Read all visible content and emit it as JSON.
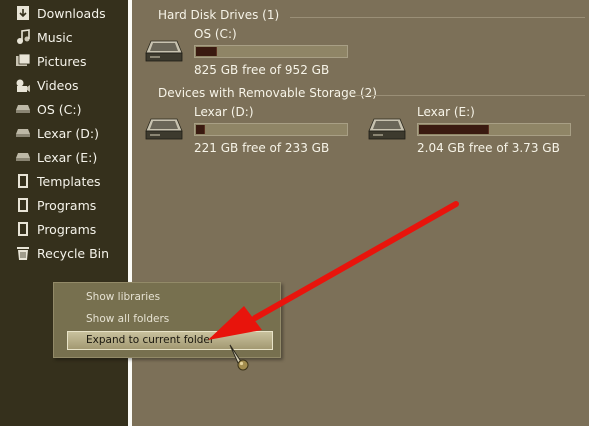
{
  "sidebar": {
    "items": [
      {
        "label": "Downloads",
        "icon": "downloads-icon"
      },
      {
        "label": "Music",
        "icon": "music-icon"
      },
      {
        "label": "Pictures",
        "icon": "pictures-icon"
      },
      {
        "label": "Videos",
        "icon": "videos-icon"
      },
      {
        "label": "OS (C:)",
        "icon": "drive-icon"
      },
      {
        "label": "Lexar (D:)",
        "icon": "drive-icon"
      },
      {
        "label": "Lexar (E:)",
        "icon": "drive-icon"
      },
      {
        "label": "Templates",
        "icon": "folder-icon"
      },
      {
        "label": "Programs",
        "icon": "folder-icon"
      },
      {
        "label": "Programs",
        "icon": "folder-icon"
      },
      {
        "label": "Recycle Bin",
        "icon": "recycle-bin-icon"
      }
    ]
  },
  "main": {
    "hard_disk_header": "Hard Disk Drives (1)",
    "removable_header": "Devices with Removable Storage (2)",
    "drives": [
      {
        "name": "OS (C:)",
        "free_text": "825 GB free of 952 GB",
        "used_fraction": 0.133
      },
      {
        "name": "Lexar (D:)",
        "free_text": "221 GB free of 233 GB",
        "used_fraction": 0.052
      },
      {
        "name": "Lexar (E:)",
        "free_text": "2.04 GB free of 3.73 GB",
        "used_fraction": 0.453
      }
    ]
  },
  "context_menu": {
    "items": [
      {
        "label": "Show libraries"
      },
      {
        "label": "Show all folders"
      },
      {
        "label": "Expand to current folder"
      }
    ]
  },
  "colors": {
    "sidebar_bg": "#35301c",
    "main_bg": "#7c7058",
    "annotation_arrow": "#e8140c",
    "drive_bar_fill": "#3a1a10"
  }
}
